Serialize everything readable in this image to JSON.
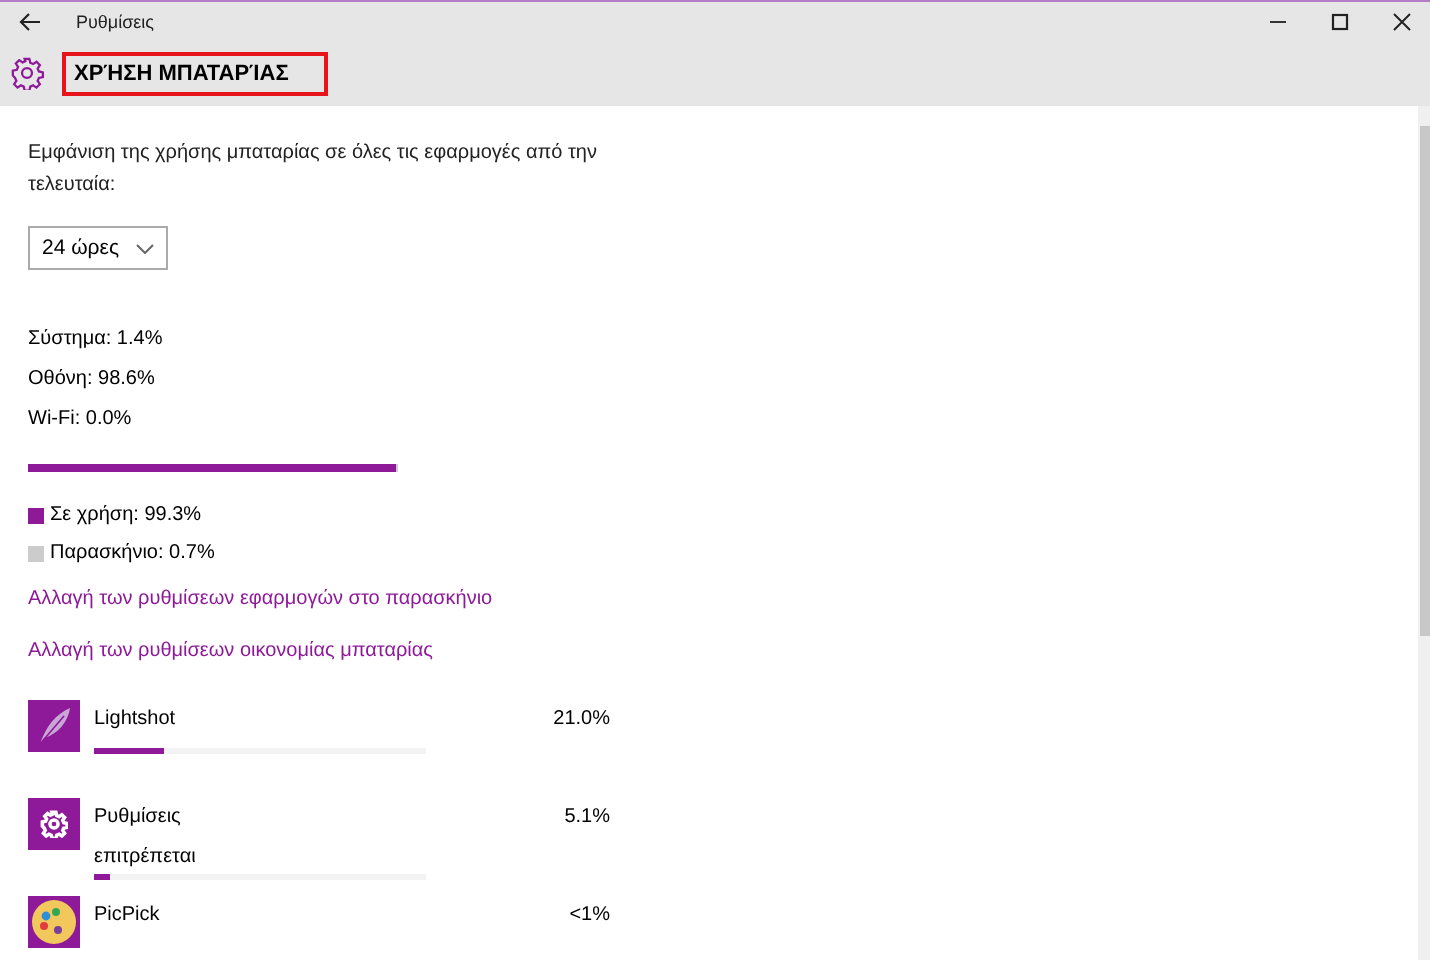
{
  "window": {
    "title": "Ρυθμίσεις"
  },
  "header": {
    "title": "ΧΡΉΣΗ ΜΠΑΤΑΡΊΑΣ",
    "highlighted": true
  },
  "description": "Εμφάνιση της χρήσης μπαταρίας σε όλες τις εφαρμογές από την τελευταία:",
  "period_dropdown": {
    "value": "24 ώρες"
  },
  "breakdown": [
    "Σύστημα: 1.4%",
    "Οθόνη: 98.6%",
    "Wi-Fi: 0.0%"
  ],
  "usage_bar": {
    "level": 0.993
  },
  "legend": [
    {
      "label": "Σε χρήση: 99.3%",
      "color": "#8e1a9a"
    },
    {
      "label": "Παρασκήνιο: 0.7%",
      "color": "#cccccc"
    }
  ],
  "links": [
    "Αλλαγή των ρυθμίσεων εφαρμογών στο παρασκήνιο",
    "Αλλαγή των ρυθμίσεων οικονομίας μπαταρίας"
  ],
  "apps": [
    {
      "name": "Lightshot",
      "kind": "feather",
      "percent": "21.0%",
      "level": 0.21
    },
    {
      "name": "Ρυθμίσεις",
      "kind": "gear",
      "percent": "5.1%",
      "status": "επιτρέπεται",
      "level": 0.051
    },
    {
      "name": "PicPick",
      "kind": "palette",
      "percent": "<1%"
    }
  ]
}
